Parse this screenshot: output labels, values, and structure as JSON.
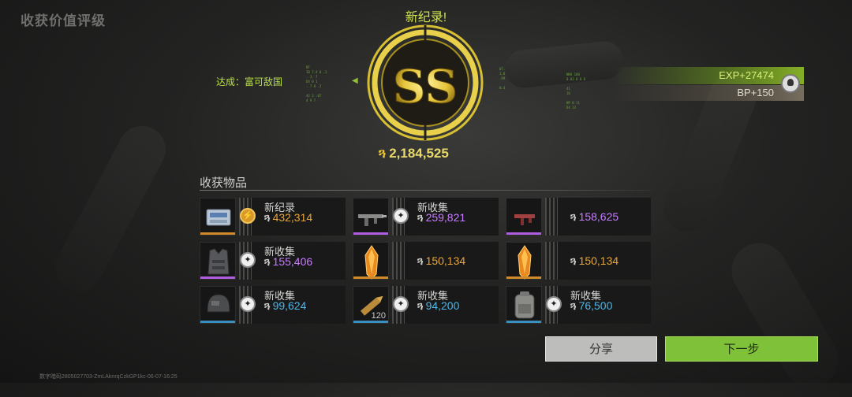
{
  "title": "收获价值评级",
  "record": "新纪录!",
  "grade": "SS",
  "score": {
    "currency_icon": "haafor-coin-icon",
    "value": "2,184,525"
  },
  "achievement": "达成：富可敌国",
  "rewards": {
    "exp": "EXP+27474",
    "bp": "BP+150"
  },
  "items_label": "收获物品",
  "items": [
    {
      "label": "新纪录",
      "value": "432,314",
      "color": "#e8a53a",
      "mark": "record",
      "rarity": "#d08a2a",
      "icon": "cash-box-icon",
      "qty": ""
    },
    {
      "label": "新收集",
      "value": "259,821",
      "color": "#c77dff",
      "mark": "new",
      "rarity": "#b05ee0",
      "icon": "rifle-icon",
      "qty": ""
    },
    {
      "label": "",
      "value": "158,625",
      "color": "#c77dff",
      "mark": "",
      "rarity": "#b05ee0",
      "icon": "smg-icon",
      "qty": ""
    },
    {
      "label": "新收集",
      "value": "155,406",
      "color": "#c77dff",
      "mark": "new",
      "rarity": "#b05ee0",
      "icon": "armor-vest-icon",
      "qty": ""
    },
    {
      "label": "",
      "value": "150,134",
      "color": "#e8a53a",
      "mark": "",
      "rarity": "#d08a2a",
      "icon": "crystal-icon",
      "qty": ""
    },
    {
      "label": "",
      "value": "150,134",
      "color": "#e8a53a",
      "mark": "",
      "rarity": "#d08a2a",
      "icon": "crystal-icon",
      "qty": ""
    },
    {
      "label": "新收集",
      "value": "99,624",
      "color": "#4fb6e8",
      "mark": "new",
      "rarity": "#3a8fc0",
      "icon": "helmet-icon",
      "qty": ""
    },
    {
      "label": "新收集",
      "value": "94,200",
      "color": "#4fb6e8",
      "mark": "new",
      "rarity": "#3a8fc0",
      "icon": "ammo-icon",
      "qty": "120"
    },
    {
      "label": "新收集",
      "value": "76,500",
      "color": "#4fb6e8",
      "mark": "new",
      "rarity": "#3a8fc0",
      "icon": "backpack-icon",
      "qty": ""
    }
  ],
  "buttons": {
    "share": "分享",
    "next": "下一步"
  },
  "footer": "数字暗码2805027703-ZmLAknrqCzkGP1kc-06-07-16:25"
}
